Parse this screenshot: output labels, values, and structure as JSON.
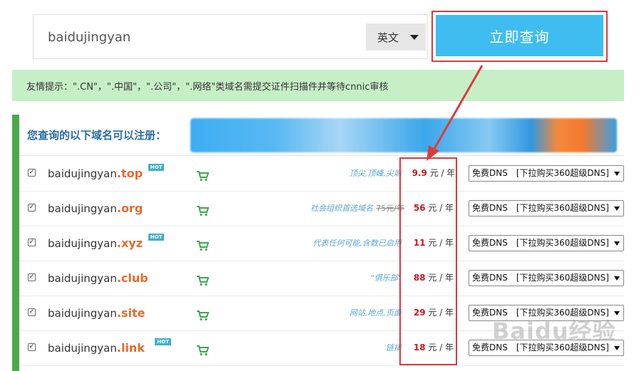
{
  "search": {
    "value": "baidujingyan",
    "language": "英文",
    "button_label": "立即查询"
  },
  "tip": "友情提示：\".CN\"，\".中国\"，\".公司\"，\".网络\"类域名需提交证件扫描件并等待cnnic审核",
  "results": {
    "title": "您查询的以下域名可以注册：",
    "rows": [
      {
        "name": "baidujingyan",
        "tld": ".top",
        "hot": "HOT",
        "desc": "顶尖,顶峰,尖端",
        "old_price": "",
        "price": "9.9",
        "unit": "元 / 年",
        "dns": "免费DNS　[下拉购买360超级DNS]"
      },
      {
        "name": "baidujingyan",
        "tld": ".org",
        "hot": "",
        "desc": "社会组织首选域名",
        "old_price": "75元/年",
        "price": "56",
        "unit": "元 / 年",
        "dns": "免费DNS　[下拉购买360超级DNS]"
      },
      {
        "name": "baidujingyan",
        "tld": ".xyz",
        "hot": "HOT",
        "desc": "代表任何可能,含数已启用",
        "old_price": "",
        "price": "11",
        "unit": "元 / 年",
        "dns": "免费DNS　[下拉购买360超级DNS]"
      },
      {
        "name": "baidujingyan",
        "tld": ".club",
        "hot": "",
        "desc": "\"俱乐部\"",
        "old_price": "",
        "price": "88",
        "unit": "元 / 年",
        "dns": "免费DNS　[下拉购买360超级DNS]"
      },
      {
        "name": "baidujingyan",
        "tld": ".site",
        "hot": "",
        "desc": "网站,地点,页面",
        "old_price": "",
        "price": "29",
        "unit": "元 / 年",
        "dns": "免费DNS　[下拉购买360超级DNS]"
      },
      {
        "name": "baidujingyan",
        "tld": ".link",
        "hot": "HOT",
        "desc": "链接",
        "old_price": "",
        "price": "18",
        "unit": "元 / 年",
        "dns": "免费DNS　[下拉购买360超级DNS]"
      }
    ]
  },
  "watermark": "Baidu经验",
  "colors": {
    "accent": "#3fbdf0",
    "highlight": "#e0393e",
    "tld": "#e9692c",
    "price": "#c8161d",
    "sidebar": "#4aa94a"
  }
}
